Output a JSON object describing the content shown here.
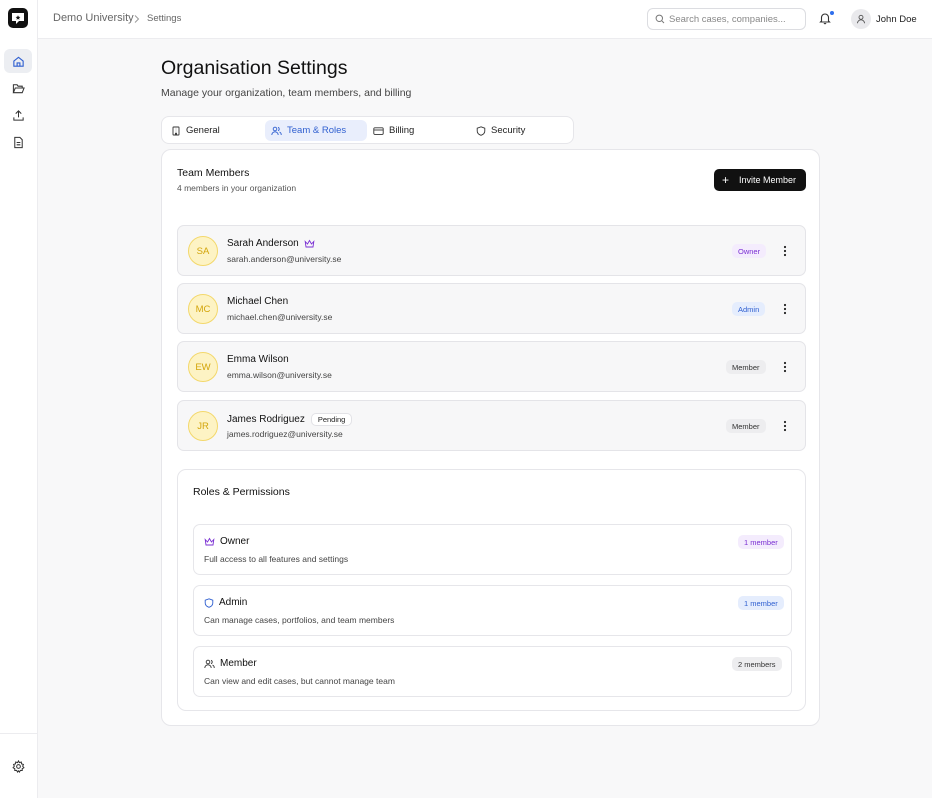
{
  "colors": {
    "accent": "#2f6fed",
    "owner_purple": "#7a2fd3",
    "admin_blue": "#2f5fd0",
    "avatar_yellow": "#d3a50b"
  },
  "breadcrumb": {
    "org": "Demo University",
    "page": "Settings"
  },
  "search": {
    "placeholder": "Search cases, companies..."
  },
  "user": {
    "name": "John Doe"
  },
  "page": {
    "title": "Organisation Settings",
    "subtitle": "Manage your organization, team members, and billing"
  },
  "tabs": [
    {
      "label": "General",
      "icon": "building-icon"
    },
    {
      "label": "Team & Roles",
      "icon": "users-icon",
      "active": true
    },
    {
      "label": "Billing",
      "icon": "credit-card-icon"
    },
    {
      "label": "Security",
      "icon": "shield-icon"
    }
  ],
  "team": {
    "title": "Team Members",
    "subtitle": "4 members in your organization",
    "invite_label": "Invite Member",
    "members": [
      {
        "initials": "SA",
        "name": "Sarah Anderson",
        "email": "sarah.anderson@university.se",
        "role": "Owner"
      },
      {
        "initials": "MC",
        "name": "Michael Chen",
        "email": "michael.chen@university.se",
        "role": "Admin"
      },
      {
        "initials": "EW",
        "name": "Emma Wilson",
        "email": "emma.wilson@university.se",
        "role": "Member"
      },
      {
        "initials": "JR",
        "name": "James Rodriguez",
        "email": "james.rodriguez@university.se",
        "role": "Member",
        "status": "Pending"
      }
    ]
  },
  "roles": {
    "title": "Roles & Permissions",
    "items": [
      {
        "name": "Owner",
        "description": "Full access to all features and settings",
        "count": "1 member",
        "icon": "crown-icon"
      },
      {
        "name": "Admin",
        "description": "Can manage cases, portfolios, and team members",
        "count": "1 member",
        "icon": "shield-icon"
      },
      {
        "name": "Member",
        "description": "Can view and edit cases, but cannot manage team",
        "count": "2 members",
        "icon": "users-icon"
      }
    ]
  }
}
